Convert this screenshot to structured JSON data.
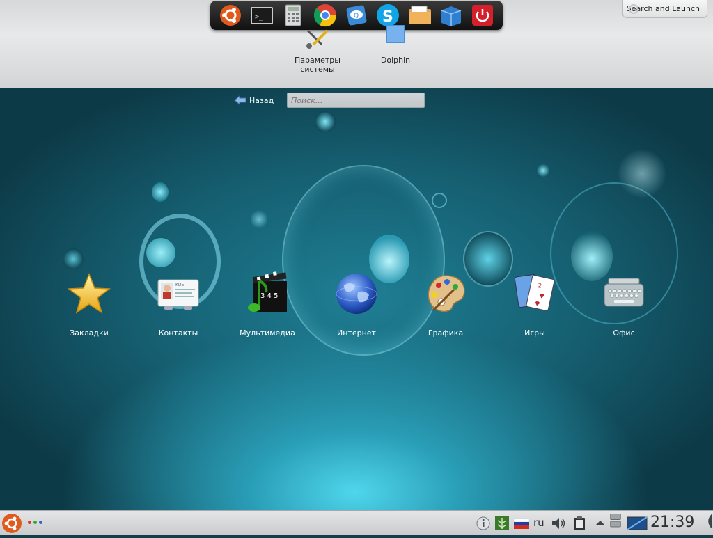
{
  "top_bar": {
    "dock_apps": [
      {
        "name": "ubuntu-icon"
      },
      {
        "name": "terminal-icon"
      },
      {
        "name": "calculator-icon"
      },
      {
        "name": "chrome-icon"
      },
      {
        "name": "quassel-icon"
      },
      {
        "name": "skype-icon"
      },
      {
        "name": "file-manager-icon"
      },
      {
        "name": "package-manager-icon"
      },
      {
        "name": "power-icon"
      }
    ],
    "favorites": [
      {
        "label": "Параметры\nсистемы"
      },
      {
        "label": "Dolphin"
      }
    ],
    "search_launch_label": "Search and Launch"
  },
  "nav": {
    "back_label": "Назад",
    "search_placeholder": "Поиск..."
  },
  "categories": [
    {
      "label": "Закладки"
    },
    {
      "label": "Контакты"
    },
    {
      "label": "Мультимедиа"
    },
    {
      "label": "Интернет"
    },
    {
      "label": "Графика"
    },
    {
      "label": "Игры"
    },
    {
      "label": "Офис"
    }
  ],
  "panel": {
    "language": "ru",
    "clock": "21:39"
  },
  "colors": {
    "background_dark": "#0d3a47",
    "background_glow": "#4fd6ec",
    "ubuntu_orange": "#e05a1e",
    "power_red": "#d4202a"
  }
}
